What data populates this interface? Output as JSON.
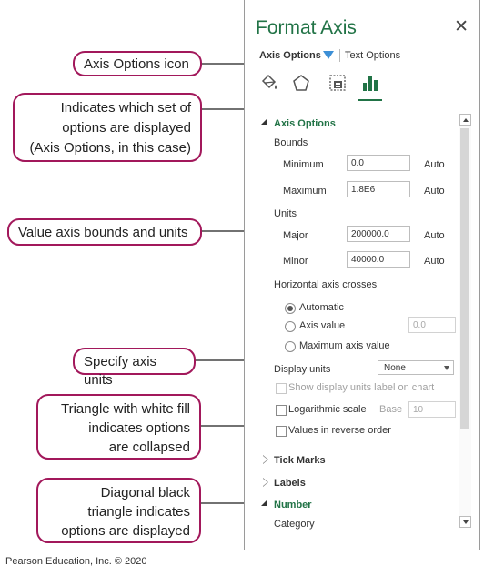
{
  "pane": {
    "title": "Format Axis",
    "close": "✕",
    "tabs": {
      "axis_options": "Axis Options",
      "text_options": "Text Options"
    },
    "icons": [
      "fill-line-icon",
      "effects-icon",
      "size-properties-icon",
      "axis-options-icon"
    ],
    "sections": {
      "axis_options": {
        "heading": "Axis Options",
        "bounds_label": "Bounds",
        "minimum_label": "Minimum",
        "minimum_value": "0.0",
        "minimum_auto": "Auto",
        "maximum_label": "Maximum",
        "maximum_value": "1.8E6",
        "maximum_auto": "Auto",
        "units_label": "Units",
        "major_label": "Major",
        "major_value": "200000.0",
        "major_auto": "Auto",
        "minor_label": "Minor",
        "minor_value": "40000.0",
        "minor_auto": "Auto",
        "crosses_label": "Horizontal axis crosses",
        "automatic_label": "Automatic",
        "axis_value_label": "Axis value",
        "axis_value_value": "0.0",
        "maximum_axis_value_label": "Maximum axis value",
        "display_units_label": "Display units",
        "display_units_value": "None",
        "show_units_label": "Show display units label on chart",
        "log_scale_label": "Logarithmic scale",
        "base_label": "Base",
        "base_value": "10",
        "reverse_label": "Values in reverse order"
      },
      "tick_marks": "Tick Marks",
      "labels": "Labels",
      "number": "Number",
      "category": "Category"
    }
  },
  "callouts": {
    "axis_options_icon": "Axis Options icon",
    "indicates_line1": "Indicates which set of",
    "indicates_line2": "options are displayed",
    "indicates_line3": "(Axis Options, in this case)",
    "bounds_units": "Value axis bounds and units",
    "specify_units": "Specify axis units",
    "white_tri_line1": "Triangle with white fill",
    "white_tri_line2": "indicates options",
    "white_tri_line3": "are collapsed",
    "black_tri_line1": "Diagonal black",
    "black_tri_line2": "triangle indicates",
    "black_tri_line3": "options are displayed"
  },
  "footer": "Pearson Education, Inc. © 2020",
  "colors": {
    "accent": "#217346",
    "callout_border": "#a2185b",
    "tab_triangle": "#3c8fd6"
  }
}
